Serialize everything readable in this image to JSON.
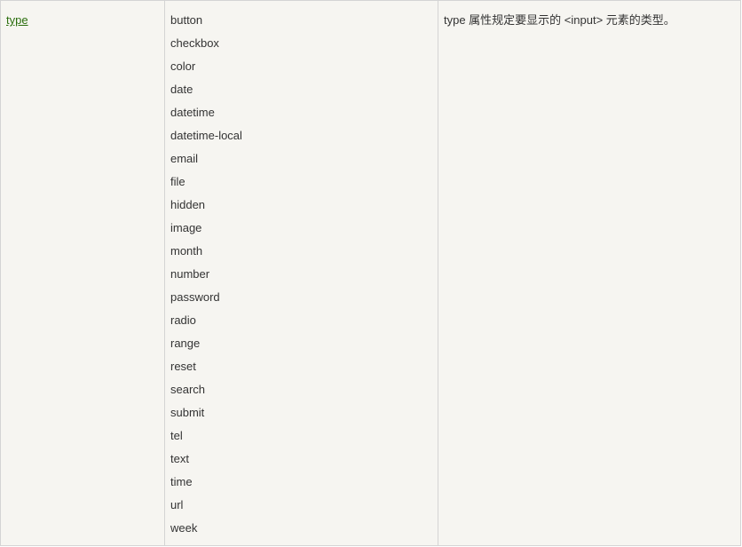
{
  "attribute": {
    "name": "type",
    "link_color": "#2b6e0e"
  },
  "values": [
    "button",
    "checkbox",
    "color",
    "date",
    "datetime",
    "datetime-local",
    "email",
    "file",
    "hidden",
    "image",
    "month",
    "number",
    "password",
    "radio",
    "range",
    "reset",
    "search",
    "submit",
    "tel",
    "text",
    "time",
    "url",
    "week"
  ],
  "description": "type 属性规定要显示的 <input> 元素的类型。",
  "colors": {
    "background": "#f6f5f1",
    "border": "#d4d4d4",
    "text": "#333333"
  }
}
